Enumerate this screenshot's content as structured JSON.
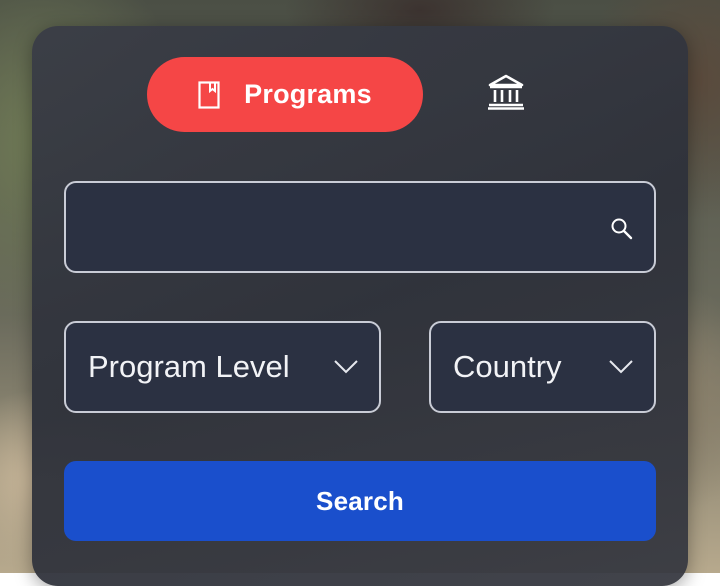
{
  "tabs": {
    "programs_label": "Programs",
    "programs_icon": "book-icon",
    "institutions_icon": "institution-icon"
  },
  "search": {
    "value": "",
    "placeholder": "",
    "icon": "search-icon"
  },
  "filters": {
    "program_level": "Program Level",
    "country": "Country",
    "chevron_icon": "chevron-down-icon"
  },
  "actions": {
    "search_button": "Search"
  },
  "colors": {
    "active_tab": "#f54646",
    "primary_button": "#1a4fcc",
    "field_background": "#2b3142",
    "field_border": "#c9ccd6"
  }
}
